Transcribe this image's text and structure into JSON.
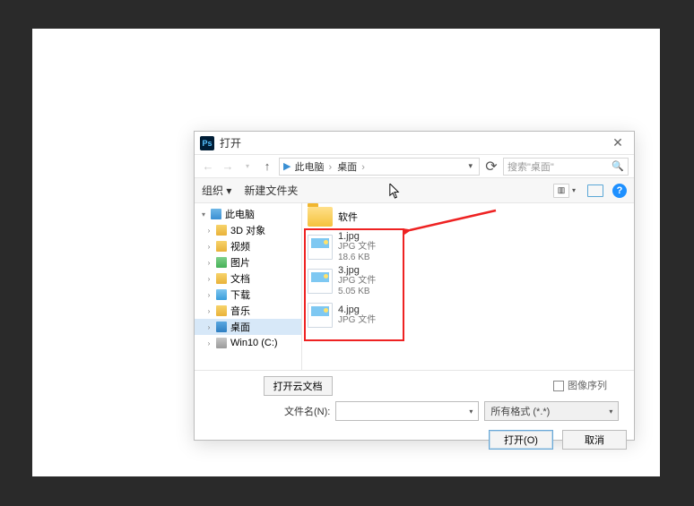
{
  "dialog": {
    "title": "打开",
    "close": "✕"
  },
  "addr": {
    "back": "←",
    "forward": "→",
    "up": "↑",
    "segments": [
      "此电脑",
      "桌面"
    ],
    "refresh": "⟳",
    "search_placeholder": "搜索\"桌面\"",
    "magnifier": "🔍"
  },
  "toolbar": {
    "organize": "组织 ▾",
    "new_folder": "新建文件夹",
    "help": "?"
  },
  "nav": {
    "root": "此电脑",
    "items": [
      {
        "label": "3D 对象",
        "icon": "ic-3d"
      },
      {
        "label": "视频",
        "icon": "ic-video"
      },
      {
        "label": "图片",
        "icon": "ic-pics"
      },
      {
        "label": "文档",
        "icon": "ic-docs"
      },
      {
        "label": "下载",
        "icon": "ic-dl"
      },
      {
        "label": "音乐",
        "icon": "ic-music"
      },
      {
        "label": "桌面",
        "icon": "ic-desk"
      },
      {
        "label": "Win10 (C:)",
        "icon": "ic-drive"
      }
    ],
    "selected_index": 6
  },
  "content": {
    "folder": {
      "name": "软件"
    },
    "files": [
      {
        "name": "1.jpg",
        "type": "JPG 文件",
        "size": "18.6 KB"
      },
      {
        "name": "3.jpg",
        "type": "JPG 文件",
        "size": "5.05 KB"
      },
      {
        "name": "4.jpg",
        "type": "JPG 文件",
        "size": ""
      }
    ]
  },
  "footer": {
    "cloud_doc": "打开云文档",
    "sequence": "图像序列",
    "filename_label": "文件名(N):",
    "filename_value": "",
    "filter": "所有格式 (*.*)",
    "open": "打开(O)",
    "cancel": "取消"
  }
}
